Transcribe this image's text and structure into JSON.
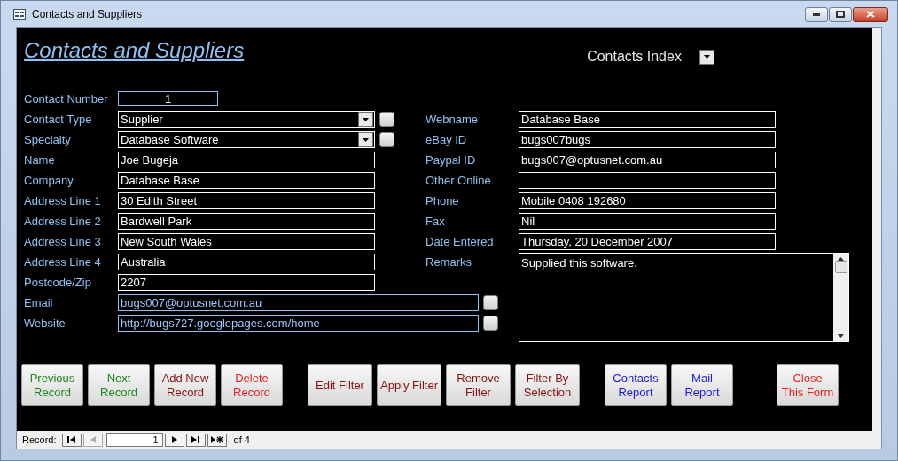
{
  "window": {
    "title": "Contacts and Suppliers"
  },
  "form_title": "Contacts and Suppliers",
  "index": {
    "label": "Contacts Index"
  },
  "left_fields": [
    {
      "label": "Contact Number",
      "value": "1",
      "kind": "number"
    },
    {
      "label": "Contact Type",
      "value": "Supplier",
      "kind": "combo"
    },
    {
      "label": "Specialty",
      "value": "Database Software",
      "kind": "combo"
    },
    {
      "label": "Name",
      "value": "Joe Bugeja",
      "kind": "text"
    },
    {
      "label": "Company",
      "value": "Database Base",
      "kind": "text"
    },
    {
      "label": "Address Line 1",
      "value": "30 Edith Street",
      "kind": "text"
    },
    {
      "label": "Address Line 2",
      "value": "Bardwell Park",
      "kind": "text"
    },
    {
      "label": "Address Line 3",
      "value": "New South Wales",
      "kind": "text"
    },
    {
      "label": "Address Line 4",
      "value": "Australia",
      "kind": "text"
    },
    {
      "label": "Postcode/Zip",
      "value": "2207",
      "kind": "text"
    },
    {
      "label": "Email",
      "value": "bugs007@optusnet.com.au",
      "kind": "link"
    },
    {
      "label": "Website",
      "value": "http://bugs727.googlepages.com/home",
      "kind": "link"
    }
  ],
  "right_fields": [
    {
      "label": "Webname",
      "value": "Database Base"
    },
    {
      "label": "eBay ID",
      "value": "bugs007bugs"
    },
    {
      "label": "Paypal ID",
      "value": "bugs007@optusnet.com.au"
    },
    {
      "label": "Other Online"
    },
    {
      "label": "Phone",
      "value": "Mobile 0408 192680"
    },
    {
      "label": "Fax",
      "value": "Nil"
    },
    {
      "label": "Date Entered",
      "value": "Thursday, 20 December 2007"
    }
  ],
  "remarks": {
    "label": "Remarks",
    "value": "Supplied this software."
  },
  "button_groups": [
    [
      {
        "lines": [
          "Previous",
          "Record"
        ],
        "color": "#1a8a1a"
      },
      {
        "lines": [
          "Next",
          "Record"
        ],
        "color": "#1a8a1a"
      },
      {
        "lines": [
          "Add New",
          "Record"
        ],
        "color": "#8b1010"
      },
      {
        "lines": [
          "Delete",
          "Record"
        ],
        "color": "#ee1c1c"
      }
    ],
    [
      {
        "lines": [
          "Edit Filter"
        ],
        "color": "#8b1010"
      },
      {
        "lines": [
          "Apply Filter"
        ],
        "color": "#8b1010"
      },
      {
        "lines": [
          "Remove",
          "Filter"
        ],
        "color": "#8b1010"
      },
      {
        "lines": [
          "Filter By",
          "Selection"
        ],
        "color": "#8b1010"
      }
    ],
    [
      {
        "lines": [
          "Contacts",
          "Report"
        ],
        "color": "#1a1aee"
      },
      {
        "lines": [
          "Mail",
          "Report"
        ],
        "color": "#1a1aee"
      }
    ],
    [
      {
        "lines": [
          "Close",
          "This Form"
        ],
        "color": "#ee1c1c"
      }
    ]
  ],
  "navigator": {
    "label": "Record:",
    "current": "1",
    "total": "of 4",
    "previous_disabled": true
  }
}
